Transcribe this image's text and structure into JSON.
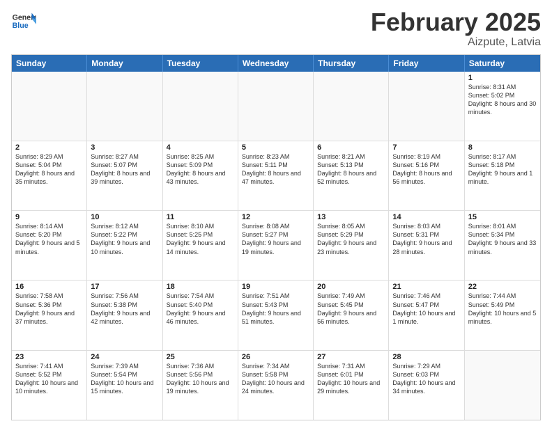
{
  "logo": {
    "line1": "General",
    "line2": "Blue"
  },
  "title": {
    "main": "February 2025",
    "sub": "Aizpute, Latvia"
  },
  "calendar": {
    "headers": [
      "Sunday",
      "Monday",
      "Tuesday",
      "Wednesday",
      "Thursday",
      "Friday",
      "Saturday"
    ],
    "weeks": [
      [
        {
          "day": "",
          "info": "",
          "empty": true
        },
        {
          "day": "",
          "info": "",
          "empty": true
        },
        {
          "day": "",
          "info": "",
          "empty": true
        },
        {
          "day": "",
          "info": "",
          "empty": true
        },
        {
          "day": "",
          "info": "",
          "empty": true
        },
        {
          "day": "",
          "info": "",
          "empty": true
        },
        {
          "day": "1",
          "info": "Sunrise: 8:31 AM\nSunset: 5:02 PM\nDaylight: 8 hours and 30 minutes."
        }
      ],
      [
        {
          "day": "2",
          "info": "Sunrise: 8:29 AM\nSunset: 5:04 PM\nDaylight: 8 hours and 35 minutes."
        },
        {
          "day": "3",
          "info": "Sunrise: 8:27 AM\nSunset: 5:07 PM\nDaylight: 8 hours and 39 minutes."
        },
        {
          "day": "4",
          "info": "Sunrise: 8:25 AM\nSunset: 5:09 PM\nDaylight: 8 hours and 43 minutes."
        },
        {
          "day": "5",
          "info": "Sunrise: 8:23 AM\nSunset: 5:11 PM\nDaylight: 8 hours and 47 minutes."
        },
        {
          "day": "6",
          "info": "Sunrise: 8:21 AM\nSunset: 5:13 PM\nDaylight: 8 hours and 52 minutes."
        },
        {
          "day": "7",
          "info": "Sunrise: 8:19 AM\nSunset: 5:16 PM\nDaylight: 8 hours and 56 minutes."
        },
        {
          "day": "8",
          "info": "Sunrise: 8:17 AM\nSunset: 5:18 PM\nDaylight: 9 hours and 1 minute."
        }
      ],
      [
        {
          "day": "9",
          "info": "Sunrise: 8:14 AM\nSunset: 5:20 PM\nDaylight: 9 hours and 5 minutes."
        },
        {
          "day": "10",
          "info": "Sunrise: 8:12 AM\nSunset: 5:22 PM\nDaylight: 9 hours and 10 minutes."
        },
        {
          "day": "11",
          "info": "Sunrise: 8:10 AM\nSunset: 5:25 PM\nDaylight: 9 hours and 14 minutes."
        },
        {
          "day": "12",
          "info": "Sunrise: 8:08 AM\nSunset: 5:27 PM\nDaylight: 9 hours and 19 minutes."
        },
        {
          "day": "13",
          "info": "Sunrise: 8:05 AM\nSunset: 5:29 PM\nDaylight: 9 hours and 23 minutes."
        },
        {
          "day": "14",
          "info": "Sunrise: 8:03 AM\nSunset: 5:31 PM\nDaylight: 9 hours and 28 minutes."
        },
        {
          "day": "15",
          "info": "Sunrise: 8:01 AM\nSunset: 5:34 PM\nDaylight: 9 hours and 33 minutes."
        }
      ],
      [
        {
          "day": "16",
          "info": "Sunrise: 7:58 AM\nSunset: 5:36 PM\nDaylight: 9 hours and 37 minutes."
        },
        {
          "day": "17",
          "info": "Sunrise: 7:56 AM\nSunset: 5:38 PM\nDaylight: 9 hours and 42 minutes."
        },
        {
          "day": "18",
          "info": "Sunrise: 7:54 AM\nSunset: 5:40 PM\nDaylight: 9 hours and 46 minutes."
        },
        {
          "day": "19",
          "info": "Sunrise: 7:51 AM\nSunset: 5:43 PM\nDaylight: 9 hours and 51 minutes."
        },
        {
          "day": "20",
          "info": "Sunrise: 7:49 AM\nSunset: 5:45 PM\nDaylight: 9 hours and 56 minutes."
        },
        {
          "day": "21",
          "info": "Sunrise: 7:46 AM\nSunset: 5:47 PM\nDaylight: 10 hours and 1 minute."
        },
        {
          "day": "22",
          "info": "Sunrise: 7:44 AM\nSunset: 5:49 PM\nDaylight: 10 hours and 5 minutes."
        }
      ],
      [
        {
          "day": "23",
          "info": "Sunrise: 7:41 AM\nSunset: 5:52 PM\nDaylight: 10 hours and 10 minutes."
        },
        {
          "day": "24",
          "info": "Sunrise: 7:39 AM\nSunset: 5:54 PM\nDaylight: 10 hours and 15 minutes."
        },
        {
          "day": "25",
          "info": "Sunrise: 7:36 AM\nSunset: 5:56 PM\nDaylight: 10 hours and 19 minutes."
        },
        {
          "day": "26",
          "info": "Sunrise: 7:34 AM\nSunset: 5:58 PM\nDaylight: 10 hours and 24 minutes."
        },
        {
          "day": "27",
          "info": "Sunrise: 7:31 AM\nSunset: 6:01 PM\nDaylight: 10 hours and 29 minutes."
        },
        {
          "day": "28",
          "info": "Sunrise: 7:29 AM\nSunset: 6:03 PM\nDaylight: 10 hours and 34 minutes."
        },
        {
          "day": "",
          "info": "",
          "empty": true
        }
      ]
    ]
  }
}
